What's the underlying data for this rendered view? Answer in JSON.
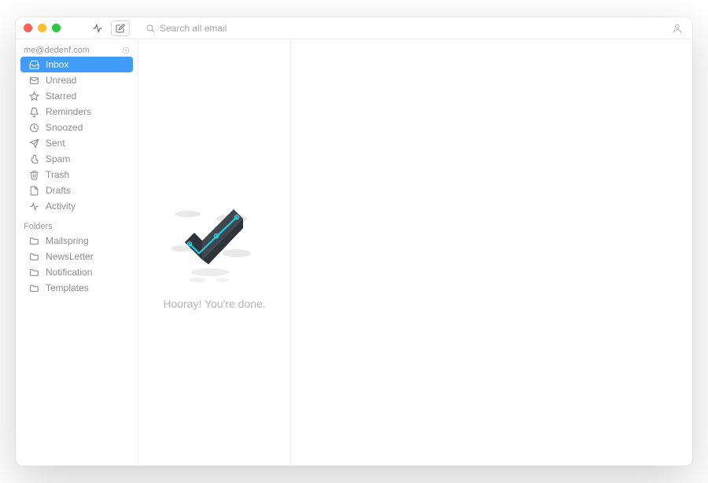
{
  "account": {
    "email": "me@dedenf.com"
  },
  "search": {
    "placeholder": "Search all email"
  },
  "sidebar": {
    "items": [
      {
        "label": "Inbox",
        "selected": true,
        "icon": "inbox"
      },
      {
        "label": "Unread",
        "selected": false,
        "icon": "mail"
      },
      {
        "label": "Starred",
        "selected": false,
        "icon": "star"
      },
      {
        "label": "Reminders",
        "selected": false,
        "icon": "bell"
      },
      {
        "label": "Snoozed",
        "selected": false,
        "icon": "clock"
      },
      {
        "label": "Sent",
        "selected": false,
        "icon": "send"
      },
      {
        "label": "Spam",
        "selected": false,
        "icon": "thumbs-down"
      },
      {
        "label": "Trash",
        "selected": false,
        "icon": "trash"
      },
      {
        "label": "Drafts",
        "selected": false,
        "icon": "file"
      },
      {
        "label": "Activity",
        "selected": false,
        "icon": "pulse"
      }
    ],
    "folders_header": "Folders",
    "folders": [
      {
        "label": "Mailspring"
      },
      {
        "label": "NewsLetter"
      },
      {
        "label": "Notification"
      },
      {
        "label": "Templates"
      }
    ]
  },
  "empty_state": {
    "message": "Hooray! You're done."
  }
}
